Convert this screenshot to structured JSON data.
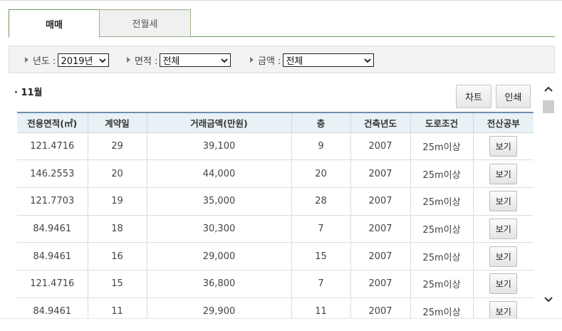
{
  "tabs": [
    {
      "label": "매매",
      "active": true
    },
    {
      "label": "전월세",
      "active": false
    }
  ],
  "filters": {
    "year": {
      "label": "년도 :",
      "value": "2019년"
    },
    "area": {
      "label": "면적 :",
      "value": "전체"
    },
    "amount": {
      "label": "금액 :",
      "value": "전체"
    }
  },
  "section": {
    "month_title": "· 11월",
    "chart_button": "차트",
    "print_button": "인쇄"
  },
  "table": {
    "headers": [
      "전용면적(㎡)",
      "계약일",
      "거래금액(만원)",
      "층",
      "건축년도",
      "도로조건",
      "전산공부"
    ],
    "rows": [
      [
        "121.4716",
        "29",
        "39,100",
        "9",
        "2007",
        "25m이상",
        "보기"
      ],
      [
        "146.2553",
        "20",
        "44,000",
        "20",
        "2007",
        "25m이상",
        "보기"
      ],
      [
        "121.7703",
        "19",
        "35,000",
        "28",
        "2007",
        "25m이상",
        "보기"
      ],
      [
        "84.9461",
        "18",
        "30,300",
        "7",
        "2007",
        "25m이상",
        "보기"
      ],
      [
        "84.9461",
        "16",
        "29,000",
        "15",
        "2007",
        "25m이상",
        "보기"
      ],
      [
        "121.4716",
        "15",
        "36,800",
        "7",
        "2007",
        "25m이상",
        "보기"
      ],
      [
        "84.9461",
        "11",
        "29,900",
        "11",
        "2007",
        "25m이상",
        "보기"
      ]
    ]
  },
  "colors": {
    "tab_border": "#6f9a5e",
    "header_bg": "#e8f1f5",
    "header_top_border": "#6a8fae"
  }
}
